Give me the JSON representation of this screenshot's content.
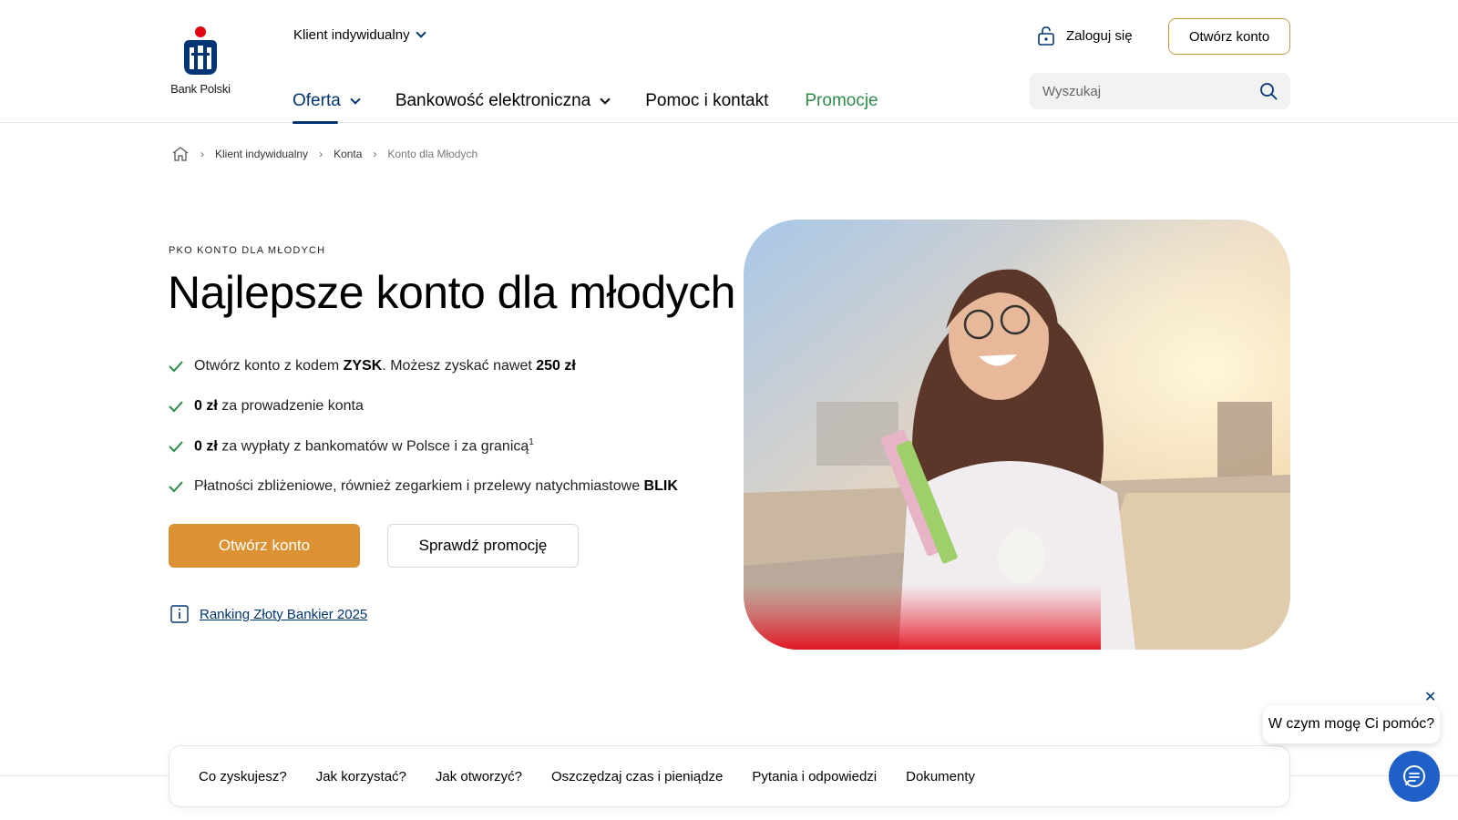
{
  "header": {
    "logo_text": "Bank Polski",
    "segment_label": "Klient indywidualny",
    "nav": [
      {
        "label": "Oferta"
      },
      {
        "label": "Bankowość elektroniczna"
      },
      {
        "label": "Pomoc i kontakt"
      },
      {
        "label": "Promocje"
      }
    ],
    "login_label": "Zaloguj się",
    "open_account_label": "Otwórz konto",
    "search_placeholder": "Wyszukaj"
  },
  "breadcrumb": {
    "items": [
      "Klient indywidualny",
      "Konta"
    ],
    "current": "Konto dla Młodych"
  },
  "hero": {
    "eyebrow": "PKO KONTO DLA MŁODYCH",
    "title": "Najlepsze konto dla młodych",
    "features": [
      {
        "pre": "Otwórz konto z kodem ",
        "b1": "ZYSK",
        "mid": ". Możesz zyskać nawet ",
        "b2": "250 zł"
      },
      {
        "b1": "0 zł",
        "text": " za prowadzenie konta"
      },
      {
        "b1": "0 zł",
        "text": " za wypłaty z bankomatów w Polsce i za granicą",
        "sup": "1"
      },
      {
        "text": "Płatności zbliżeniowe, również zegarkiem i przelewy natychmiastowe ",
        "b1": "BLIK"
      }
    ],
    "primary_button": "Otwórz konto",
    "secondary_button": "Sprawdź promocję",
    "ranking_link": "Ranking Złoty Bankier 2025"
  },
  "tabs": [
    "Co zyskujesz?",
    "Jak korzystać?",
    "Jak otworzyć?",
    "Oszczędzaj czas i pieniądze",
    "Pytania i odpowiedzi",
    "Dokumenty"
  ],
  "chat": {
    "bubble_text": "W czym mogę Ci pomóc?",
    "close_symbol": "✕"
  },
  "colors": {
    "brand_navy": "#003574",
    "accent_orange": "#dc9232",
    "promo_green": "#2e8b4a",
    "logo_red": "#e30613",
    "chat_blue": "#1e5fc8"
  }
}
